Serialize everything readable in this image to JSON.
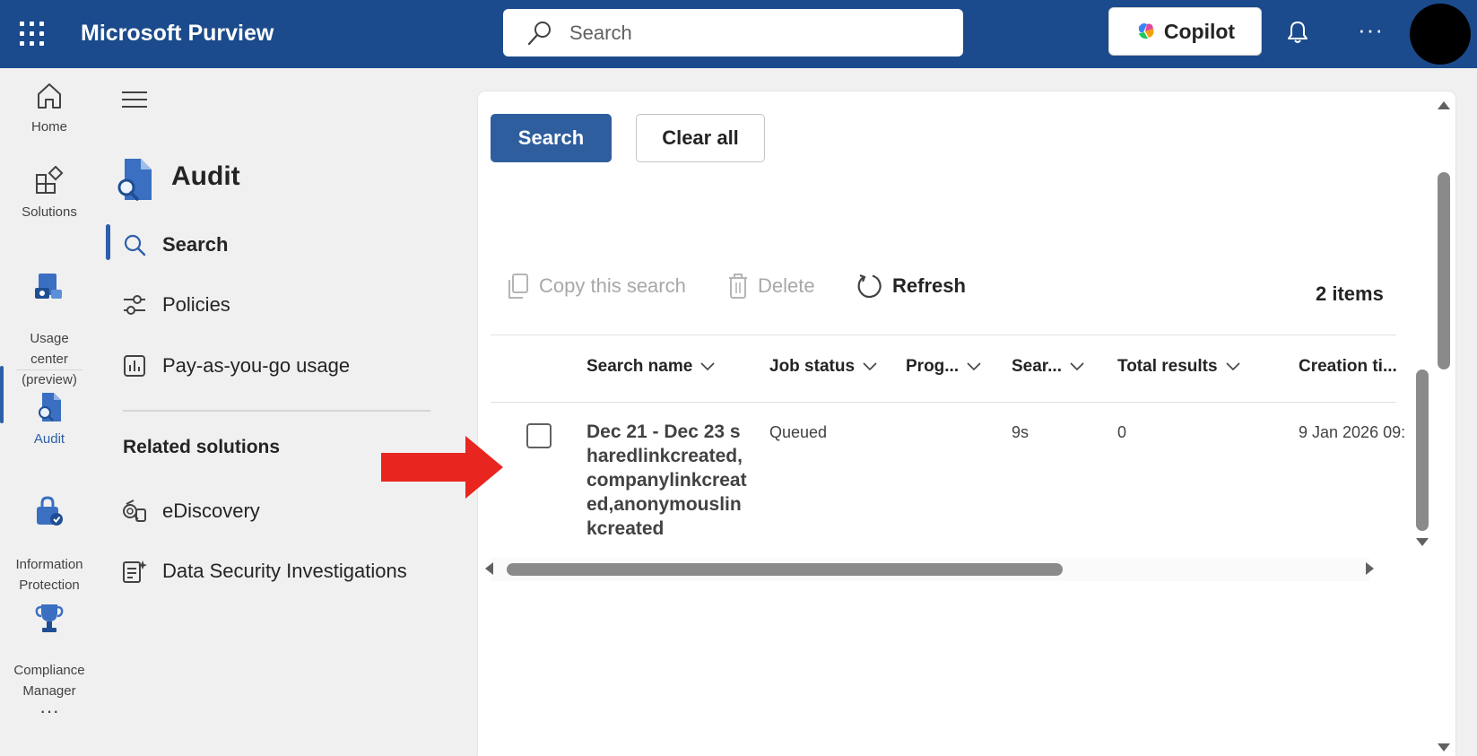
{
  "header": {
    "app_title": "Microsoft Purview",
    "search_placeholder": "Search",
    "copilot_label": "Copilot",
    "more_label": "···"
  },
  "rail": {
    "items": [
      {
        "label": "Home",
        "icon": "home-icon"
      },
      {
        "label": "Solutions",
        "icon": "solutions-icon"
      },
      {
        "label": "Usage\ncenter\n(preview)",
        "icon": "usage-center-icon"
      },
      {
        "label": "Audit",
        "icon": "audit-icon"
      },
      {
        "label": "Information\nProtection",
        "icon": "information-protection-icon"
      },
      {
        "label": "Compliance\nManager",
        "icon": "compliance-manager-icon"
      }
    ],
    "more_label": "···"
  },
  "nav": {
    "section_title": "Audit",
    "items": [
      {
        "label": "Search",
        "icon": "search-icon",
        "active": true
      },
      {
        "label": "Policies",
        "icon": "sliders-icon"
      },
      {
        "label": "Pay-as-you-go usage",
        "icon": "chart-icon"
      }
    ],
    "related_heading": "Related solutions",
    "related": [
      {
        "label": "eDiscovery",
        "icon": "ediscovery-icon"
      },
      {
        "label": "Data Security Investigations",
        "icon": "investigations-icon"
      }
    ]
  },
  "content": {
    "search_button": "Search",
    "clear_button": "Clear all",
    "toolbar": {
      "copy_label": "Copy this search",
      "delete_label": "Delete",
      "refresh_label": "Refresh",
      "items_count": "2 items"
    },
    "columns": [
      "Search name",
      "Job status",
      "Prog...",
      "Sear...",
      "Total results",
      "Creation ti..."
    ],
    "rows": [
      {
        "search_name": "Dec 21 - Dec 23 sharedlinkcreated,companylinkcreated,anonymouslinkcreated",
        "job_status": "Queued",
        "progress": "",
        "search_time": "9s",
        "total_results": "0",
        "creation_time": "9 Jan 2026 09:"
      }
    ]
  },
  "colors": {
    "header_bg": "#1b4b8c",
    "primary_button": "#2f5e9e",
    "annotation_arrow": "#e8251f"
  }
}
